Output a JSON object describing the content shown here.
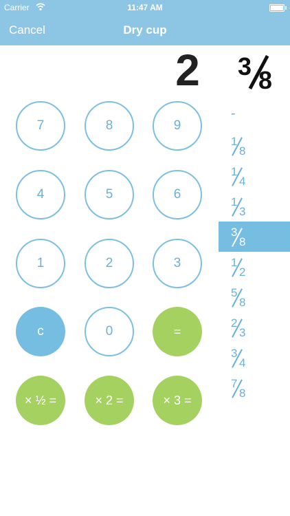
{
  "status": {
    "carrier": "Carrier",
    "time": "11:47 AM"
  },
  "nav": {
    "cancel": "Cancel",
    "title": "Dry cup"
  },
  "display": {
    "whole": "2",
    "fraction": {
      "numerator": "3",
      "denominator": "8"
    }
  },
  "keypad": {
    "k7": "7",
    "k8": "8",
    "k9": "9",
    "k4": "4",
    "k5": "5",
    "k6": "6",
    "k1": "1",
    "k2": "2",
    "k3": "3",
    "clear": "c",
    "k0": "0",
    "equals": "=",
    "half": "× ½ =",
    "double": "× 2 =",
    "triple": "× 3 ="
  },
  "fractions": {
    "none": "-",
    "f1": {
      "n": "1",
      "d": "8"
    },
    "f2": {
      "n": "1",
      "d": "4"
    },
    "f3": {
      "n": "1",
      "d": "3"
    },
    "f4": {
      "n": "3",
      "d": "8"
    },
    "f5": {
      "n": "1",
      "d": "2"
    },
    "f6": {
      "n": "5",
      "d": "8"
    },
    "f7": {
      "n": "2",
      "d": "3"
    },
    "f8": {
      "n": "3",
      "d": "4"
    },
    "f9": {
      "n": "7",
      "d": "8"
    }
  },
  "colors": {
    "header": "#8cc6e4",
    "accent_blue": "#76bde2",
    "accent_green": "#a4d160"
  }
}
